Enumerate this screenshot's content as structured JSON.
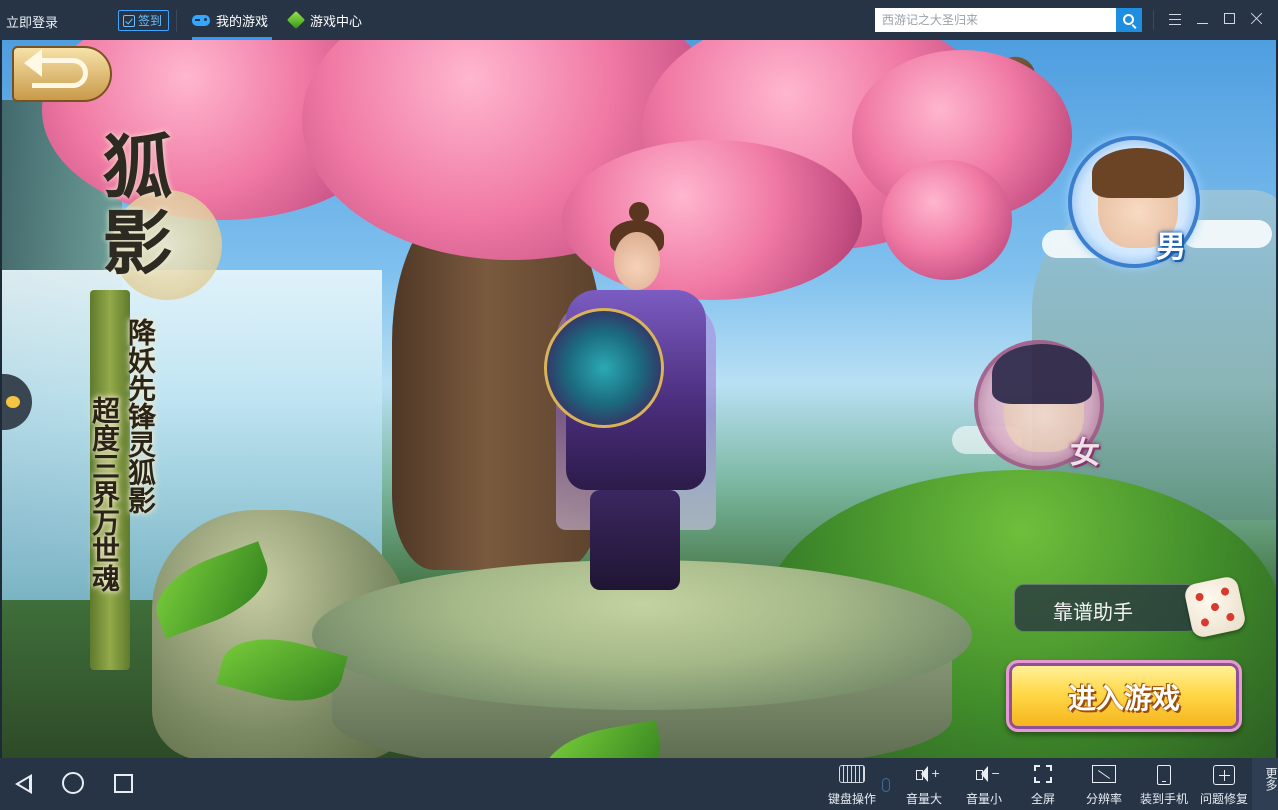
{
  "topbar": {
    "login_label": "立即登录",
    "signin_label": "签到",
    "tabs": [
      {
        "label": "我的游戏",
        "icon": "gamepad-icon",
        "active": true
      },
      {
        "label": "游戏中心",
        "icon": "cube-icon",
        "active": false
      }
    ],
    "search": {
      "placeholder": "西游记之大圣归来",
      "value": ""
    },
    "accent_color": "#2f9bff"
  },
  "game": {
    "character": {
      "name": "狐影",
      "title": "降妖先锋灵狐影",
      "motto": "超度三界万世魂"
    },
    "gender_options": [
      {
        "label": "男",
        "selected": true
      },
      {
        "label": "女",
        "selected": false
      }
    ],
    "assistant_label": "靠谱助手",
    "enter_label": "进入游戏"
  },
  "bottombar": {
    "tools": [
      {
        "label": "键盘操作",
        "icon": "keyboard-icon"
      },
      {
        "label": "音量大",
        "icon": "volume-up-icon"
      },
      {
        "label": "音量小",
        "icon": "volume-down-icon"
      },
      {
        "label": "全屏",
        "icon": "fullscreen-icon"
      },
      {
        "label": "分辨率",
        "icon": "resolution-icon"
      },
      {
        "label": "装到手机",
        "icon": "phone-icon"
      },
      {
        "label": "问题修复",
        "icon": "repair-icon"
      }
    ],
    "more_label": "更多"
  }
}
